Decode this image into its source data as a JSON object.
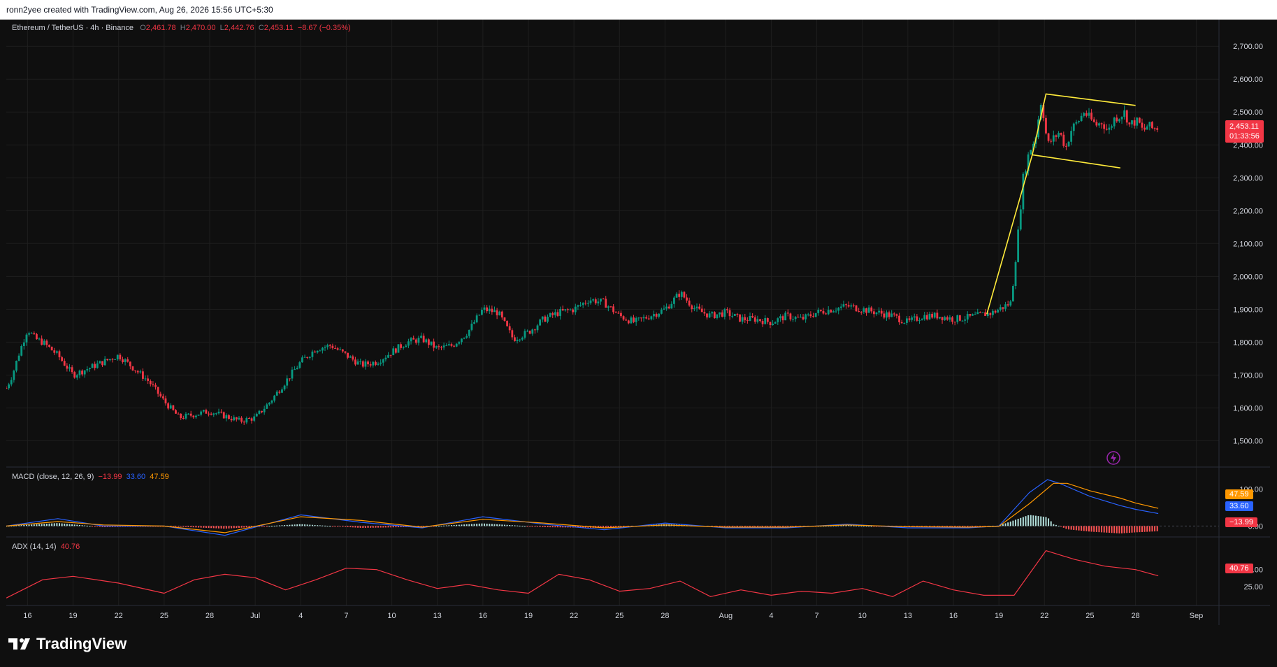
{
  "header": {
    "caption": "ronn2yee created with TradingView.com, Aug 26, 2026 15:56 UTC+5:30"
  },
  "brand": {
    "name": "TradingView"
  },
  "colors": {
    "up": "#089981",
    "down": "#f23645",
    "macd": "#2962ff",
    "signal": "#ff9800",
    "adx": "#f23645",
    "pattern": "#ffeb3b",
    "grid": "#1e1e1e"
  },
  "legend": {
    "symbol": "Ethereum / TetherUS · 4h · Binance",
    "o_label": "O",
    "o_value": "2,461.78",
    "h_label": "H",
    "h_value": "2,470.00",
    "l_label": "L",
    "l_value": "2,442.76",
    "c_label": "C",
    "c_value": "2,453.11",
    "change": "−8.67 (−0.35%)"
  },
  "macd_legend": {
    "title": "MACD (close, 12, 26, 9)",
    "hist": "−13.99",
    "macd": "33.60",
    "signal": "47.59"
  },
  "adx_legend": {
    "title": "ADX (14, 14)",
    "value": "40.76"
  },
  "price_label": {
    "price": "2,453.11",
    "countdown": "01:33:56"
  },
  "chart_data": [
    {
      "type": "candlestick",
      "title": "Ethereum / TetherUS · 4h · Binance",
      "ylim": [
        1420,
        2760
      ],
      "y_ticks": [
        1500,
        1600,
        1700,
        1800,
        1900,
        2000,
        2100,
        2200,
        2300,
        2400,
        2500,
        2600,
        2700
      ],
      "y_tick_labels": [
        "1,500.00",
        "1,600.00",
        "1,700.00",
        "1,800.00",
        "1,900.00",
        "2,000.00",
        "2,100.00",
        "2,200.00",
        "2,300.00",
        "2,400.00",
        "2,500.00",
        "2,600.00",
        "2,700.00"
      ],
      "x_ticks": [
        "16",
        "19",
        "22",
        "25",
        "28",
        "Jul",
        "4",
        "7",
        "10",
        "13",
        "16",
        "19",
        "22",
        "25",
        "28",
        "Aug",
        "4",
        "7",
        "10",
        "13",
        "16",
        "19",
        "22",
        "25",
        "28",
        "Sep"
      ],
      "x_tick_days": [
        0,
        3,
        6,
        9,
        12,
        15,
        18,
        21,
        24,
        27,
        30,
        33,
        36,
        39,
        42,
        46,
        49,
        52,
        55,
        58,
        61,
        64,
        67,
        70,
        73,
        77
      ],
      "x_range_days": [
        -1.4,
        78.5
      ],
      "path_days": [
        -1.4,
        -1,
        -0.6,
        0,
        0.5,
        1,
        2,
        3,
        4,
        5,
        6,
        7,
        8,
        9,
        10,
        11,
        12,
        13,
        14,
        15,
        16,
        17,
        18,
        19,
        20,
        21,
        22,
        23,
        24,
        25,
        26,
        27,
        28,
        29,
        30,
        31,
        32,
        33,
        34,
        35,
        36,
        37,
        38,
        39,
        40,
        41,
        42,
        43,
        44,
        45,
        46,
        47,
        48,
        49,
        50,
        51,
        52,
        53,
        54,
        55,
        56,
        57,
        58,
        59,
        60,
        61,
        62,
        62.5,
        63,
        63.5,
        64,
        64.4,
        64.8,
        65.2,
        65.6,
        66,
        66.4,
        66.8,
        67.2,
        67.6,
        68,
        68.4,
        68.8,
        69.2,
        69.6,
        70,
        70.4,
        70.8,
        71.2,
        71.6,
        72,
        72.3,
        72.6,
        72.9,
        73.2,
        73.5,
        73.8,
        74.1,
        74.5
      ],
      "path_close": [
        1660,
        1700,
        1760,
        1840,
        1810,
        1800,
        1760,
        1700,
        1720,
        1740,
        1760,
        1720,
        1680,
        1620,
        1570,
        1580,
        1590,
        1575,
        1560,
        1570,
        1620,
        1680,
        1740,
        1780,
        1790,
        1760,
        1730,
        1740,
        1770,
        1800,
        1810,
        1780,
        1790,
        1830,
        1900,
        1890,
        1810,
        1830,
        1870,
        1890,
        1900,
        1930,
        1920,
        1880,
        1860,
        1880,
        1900,
        1950,
        1900,
        1880,
        1890,
        1870,
        1870,
        1860,
        1880,
        1870,
        1890,
        1900,
        1910,
        1900,
        1890,
        1880,
        1860,
        1880,
        1880,
        1870,
        1875,
        1880,
        1885,
        1888,
        1900,
        1910,
        1920,
        2100,
        2300,
        2380,
        2420,
        2540,
        2400,
        2420,
        2440,
        2390,
        2450,
        2470,
        2500,
        2480,
        2460,
        2470,
        2440,
        2480,
        2490,
        2500,
        2460,
        2470,
        2470,
        2440,
        2460,
        2450,
        2453
      ],
      "series": [
        {
          "name": "",
          "kind": "pattern",
          "points": [
            [
              63.2,
              1885
            ],
            [
              66.2,
              2370
            ],
            [
              67.1,
              2555
            ],
            [
              73.0,
              2520
            ]
          ]
        },
        {
          "name": "",
          "kind": "pattern",
          "points": [
            [
              66.2,
              2370
            ],
            [
              72.0,
              2330
            ]
          ]
        }
      ]
    },
    {
      "type": "line",
      "title": "MACD (close, 12, 26, 9)",
      "ylim": [
        -20,
        140
      ],
      "y_ticks": [
        100,
        0
      ],
      "y_tick_labels": [
        "100.00",
        "0.00"
      ],
      "last_values": {
        "hist": -13.99,
        "macd": 33.6,
        "signal": 47.59
      },
      "series": [
        {
          "name": "MACD",
          "x": [
            -1.4,
            2,
            5,
            9,
            13,
            18,
            22,
            26,
            30,
            34,
            38,
            42,
            46,
            50,
            54,
            58,
            62,
            64,
            66,
            67.2,
            68,
            70,
            72,
            73,
            74.5
          ],
          "y": [
            0,
            20,
            0,
            0,
            -25,
            30,
            10,
            -5,
            25,
            5,
            -10,
            8,
            -5,
            -5,
            5,
            -5,
            -5,
            0,
            90,
            125,
            115,
            80,
            55,
            45,
            33.6
          ]
        },
        {
          "name": "signal",
          "x": [
            -1.4,
            2,
            5,
            9,
            13,
            18,
            22,
            26,
            30,
            34,
            38,
            42,
            46,
            50,
            54,
            58,
            62,
            64,
            66,
            67.6,
            68.5,
            70,
            72,
            73,
            74.5
          ],
          "y": [
            0,
            12,
            3,
            0,
            -18,
            25,
            15,
            -3,
            18,
            8,
            -5,
            3,
            -3,
            -3,
            3,
            -2,
            -3,
            -1,
            60,
            115,
            115,
            95,
            75,
            62,
            47.59
          ]
        }
      ]
    },
    {
      "type": "line",
      "title": "ADX (14, 14)",
      "ylim": [
        0,
        90
      ],
      "y_ticks": [
        50,
        25
      ],
      "y_tick_labels": [
        "50.00",
        "25.00"
      ],
      "series": [
        {
          "name": "ADX",
          "x": [
            -1.4,
            1,
            3,
            6,
            9,
            11,
            13,
            15,
            17,
            19,
            21,
            23,
            25,
            27,
            29,
            31,
            33,
            35,
            37,
            39,
            41,
            43,
            45,
            47,
            49,
            51,
            53,
            55,
            57,
            59,
            61,
            63,
            65,
            67.1,
            69,
            71,
            73,
            74.5
          ],
          "y": [
            8,
            35,
            40,
            30,
            15,
            35,
            43,
            38,
            20,
            35,
            52,
            50,
            35,
            22,
            28,
            20,
            15,
            43,
            35,
            18,
            22,
            33,
            10,
            20,
            12,
            18,
            15,
            22,
            10,
            33,
            20,
            12,
            12,
            78,
            65,
            55,
            50,
            40.76
          ]
        }
      ]
    }
  ]
}
